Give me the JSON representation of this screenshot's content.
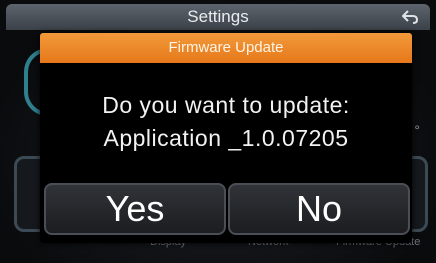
{
  "header": {
    "title": "Settings",
    "back_icon": "back-arrow-icon"
  },
  "background": {
    "degree_symbol": "°",
    "label_display": "Display",
    "label_network": "Network",
    "label_update": "Firmware Update"
  },
  "dialog": {
    "title": "Firmware Update",
    "message_line1": "Do you want to update:",
    "message_line2": "Application _1.0.07205",
    "yes_label": "Yes",
    "no_label": "No"
  },
  "colors": {
    "dialog_title_bg": "#e6781a",
    "header_bg": "#4a5058",
    "dialog_bg": "#000000"
  }
}
